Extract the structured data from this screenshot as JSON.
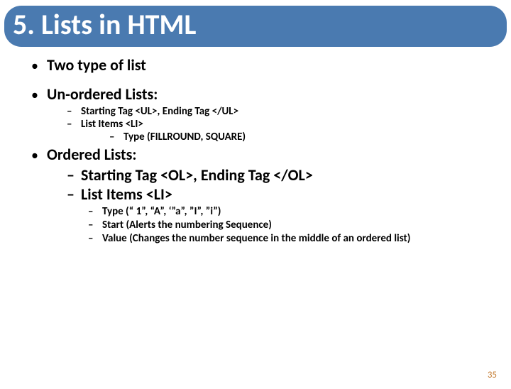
{
  "title": "5. Lists in HTML",
  "bullets": {
    "l1": [
      {
        "text": "Two type of list"
      },
      {
        "text": "Un-ordered Lists:"
      },
      {
        "text": "Ordered Lists:"
      }
    ],
    "unordered_sub": [
      {
        "text": "Starting Tag   <UL>, Ending Tag </UL>"
      },
      {
        "text": "List Items   <LI>"
      }
    ],
    "unordered_sub_sub": [
      {
        "text": "Type  (FILLROUND, SQUARE)"
      }
    ],
    "ordered_sub_large": [
      {
        "text": "Starting Tag <OL>, Ending Tag </OL>"
      },
      {
        "text": "List Items <LI>"
      }
    ],
    "ordered_sub_small": [
      {
        "text": "Type (“ 1”, “A”, ‘”a”, ”I”, ”i”)"
      },
      {
        "text": "Start (Alerts the numbering Sequence)"
      },
      {
        "text": "Value (Changes the number sequence in the middle of an ordered list)"
      }
    ]
  },
  "page_number": "35"
}
